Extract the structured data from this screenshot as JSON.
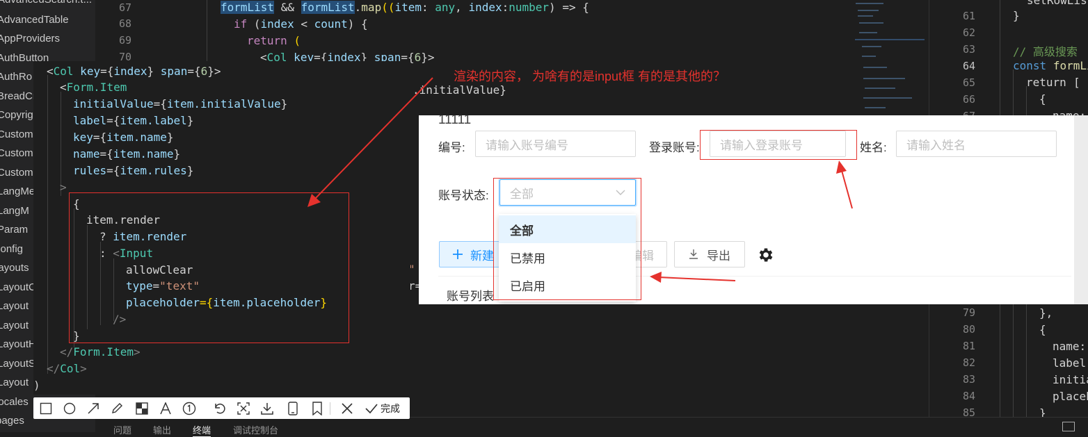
{
  "explorer": {
    "items": [
      "AdvancedSearch.t...",
      "AdvancedTable",
      "AppProviders",
      "AuthButton",
      "AuthRo",
      "BreadCr",
      "Copyrig",
      "Custom",
      "Custom",
      "Custom",
      "LangMe",
      "LangM",
      "Param",
      "config",
      "layouts",
      "LayoutC",
      "Layout",
      "Layout",
      "LayoutH",
      "LayoutS",
      "Layout",
      "locales",
      "pages"
    ]
  },
  "editor_main": {
    "line_numbers": [
      "67",
      "68",
      "69",
      "70"
    ],
    "lines": {
      "l67": {
        "a": "formList",
        "b": " && ",
        "c": "formList",
        "d": ".",
        "e": "map",
        "f": "((",
        "g": "item",
        "h": ": ",
        "i": "any",
        "j": ", ",
        "k": "index",
        "l": ":",
        "m": "number",
        "n": ") => {"
      },
      "l68": {
        "a": "if",
        "b": " (",
        "c": "index",
        "d": " < ",
        "e": "count",
        "f": ") {"
      },
      "l69": {
        "a": "return",
        "b": " ("
      },
      "l70": {
        "a": "<",
        "b": "Col",
        "c": " key",
        "d": "={",
        "e": "index",
        "f": "}",
        "g": " span",
        "h": "={",
        "i": "6",
        "j": "}>"
      }
    },
    "fragment_initial": ".initialValue}",
    "fragment_quote": "\"",
    "fragment_r": "r="
  },
  "editor_right": {
    "line_numbers": [
      "61",
      "62",
      "63",
      "64",
      "65",
      "66",
      "67",
      "79",
      "80",
      "81",
      "82",
      "83",
      "84",
      "85"
    ],
    "top_fragment": "setRowLis",
    "brace_61": "}",
    "comment_63": "// 高级搜索",
    "const_kw": "const",
    "const_name": "formLi",
    "return_kw": "return",
    "bracket": "[",
    "brace_open": "{",
    "name_key": "name:",
    "close_obj": "},",
    "name_key2": "name:",
    "label_key": "label",
    "initial_key": "initia",
    "placeholder_key": "placeh",
    "closing_85": "}"
  },
  "popup": {
    "l1": {
      "a": "<",
      "b": "Col",
      "c": " key",
      "d": "={",
      "e": "index",
      "f": "}",
      "g": " span",
      "h": "={",
      "i": "6",
      "j": "}>"
    },
    "l2": {
      "a": "<",
      "b": "Form.Item"
    },
    "l3": {
      "a": "initialValue",
      "b": "={",
      "c": "item.initialValue",
      "d": "}"
    },
    "l4": {
      "a": "label",
      "b": "={",
      "c": "item.label",
      "d": "}"
    },
    "l5": {
      "a": "key",
      "b": "={",
      "c": "item.name",
      "d": "}"
    },
    "l6": {
      "a": "name",
      "b": "={",
      "c": "item.name",
      "d": "}"
    },
    "l7": {
      "a": "rules",
      "b": "={",
      "c": "item.rules",
      "d": "}"
    },
    "l8": ">",
    "l9": "{",
    "l10": "item.render",
    "l11": {
      "a": "? ",
      "b": "item.render"
    },
    "l12": {
      "a": ": ",
      "b": "<",
      "c": "Input"
    },
    "l13": "allowClear",
    "l14": {
      "a": "type",
      "b": "=",
      "c": "\"text\""
    },
    "l15": {
      "a": "placeholder",
      "b": "={",
      "c": "item.placeholder",
      "d": "}"
    },
    "l16": "/>",
    "l17": "}",
    "l18": {
      "a": "</",
      "b": "Form.Item",
      "c": ">"
    },
    "l19": {
      "a": "</",
      "b": "Col",
      "c": ">"
    },
    "l20": ")"
  },
  "annotation": {
    "text": "渲染的内容， 为啥有的是input框 有的是其他的？"
  },
  "toolbar": {
    "done_label": "完成",
    "tools": [
      "rectangle-icon",
      "ellipse-icon",
      "arrow-icon",
      "pen-icon",
      "mosaic-icon",
      "text-icon",
      "number-icon",
      "undo-icon",
      "pin-icon",
      "download-icon",
      "mobile-icon",
      "bookmark-icon",
      "close-icon",
      "check-icon"
    ]
  },
  "web_form": {
    "top_text": "11111",
    "fields": [
      {
        "label": "编号:",
        "placeholder": "请输入账号编号"
      },
      {
        "label": "登录账号:",
        "placeholder": "请输入登录账号"
      },
      {
        "label": "姓名:",
        "placeholder": "请输入姓名"
      }
    ],
    "status_label": "账号状态:",
    "status_value": "全部",
    "options": [
      "全部",
      "已禁用",
      "已启用"
    ],
    "new_button": "新建",
    "edit_button": "编辑",
    "export_button": "导出",
    "list_title": "账号列表"
  },
  "panel_tabs": [
    "问题",
    "输出",
    "终端",
    "调试控制台"
  ],
  "colors": {
    "annotation_red": "#e5322d",
    "primary": "#1890ff",
    "editor_bg": "#1e1e1e"
  }
}
